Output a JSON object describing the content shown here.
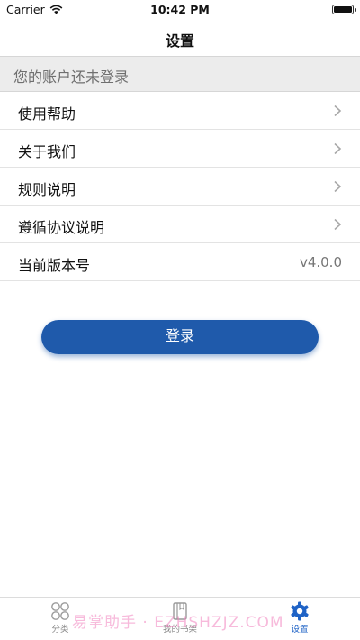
{
  "status_bar": {
    "carrier": "Carrier",
    "time": "10:42 PM",
    "battery_level": 1.0
  },
  "nav": {
    "title": "设置"
  },
  "account": {
    "notice": "您的账户还未登录"
  },
  "menu": {
    "items": [
      {
        "label": "使用帮助",
        "icon": "chevron-right-icon"
      },
      {
        "label": "关于我们",
        "icon": "chevron-right-icon"
      },
      {
        "label": "规则说明",
        "icon": "chevron-right-icon"
      },
      {
        "label": "遵循协议说明",
        "icon": "chevron-right-icon"
      }
    ],
    "version": {
      "label": "当前版本号",
      "value": "v4.0.0"
    }
  },
  "login_button": {
    "label": "登录"
  },
  "tab_bar": {
    "tabs": [
      {
        "label": "分类",
        "icon": "grid-icon"
      },
      {
        "label": "我的书架",
        "icon": "book-icon"
      },
      {
        "label": "设置",
        "icon": "gear-icon"
      }
    ]
  },
  "watermark": {
    "text": "易掌助手 · EZHSHZJZ.COM"
  },
  "colors": {
    "accent": "#1f5aab",
    "active_tab": "#1f63c6",
    "banner_bg": "#ececec",
    "watermark": "#f082be"
  }
}
